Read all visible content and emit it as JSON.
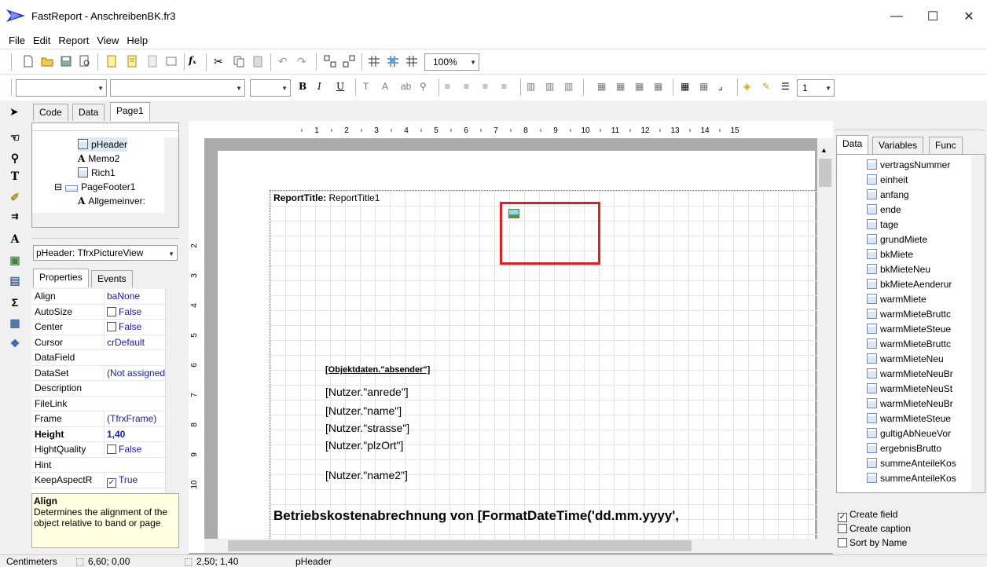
{
  "window": {
    "title": "FastReport - AnschreibenBK.fr3",
    "minimize": "—",
    "maximize": "☐",
    "close": "✕"
  },
  "menu": [
    "File",
    "Edit",
    "Report",
    "View",
    "Help"
  ],
  "toolbar": {
    "zoom": "100%",
    "line_width": "1"
  },
  "tabs": [
    "Code",
    "Data",
    "Page1"
  ],
  "tree": {
    "items": [
      {
        "label": "pHeader",
        "icon": "picture-icon"
      },
      {
        "label": "Memo2",
        "icon": "text-icon"
      },
      {
        "label": "Rich1",
        "icon": "rich-text-icon"
      },
      {
        "label": "PageFooter1",
        "icon": "band-icon"
      },
      {
        "label": "Allgemeinver:",
        "icon": "text-icon"
      }
    ]
  },
  "inspector": {
    "object_combo": "pHeader: TfrxPictureView",
    "tabs": [
      "Properties",
      "Events"
    ],
    "props": [
      {
        "name": "Align",
        "value": "baNone"
      },
      {
        "name": "AutoSize",
        "value": "False",
        "checkbox": true,
        "checked": false
      },
      {
        "name": "Center",
        "value": "False",
        "checkbox": true,
        "checked": false
      },
      {
        "name": "Cursor",
        "value": "crDefault"
      },
      {
        "name": "DataField",
        "value": ""
      },
      {
        "name": "DataSet",
        "value": "(Not assigned)"
      },
      {
        "name": "Description",
        "value": ""
      },
      {
        "name": "FileLink",
        "value": ""
      },
      {
        "name": "Frame",
        "value": "(TfrxFrame)",
        "expand": "⊞"
      },
      {
        "name": "Height",
        "value": "1,40",
        "bold": true
      },
      {
        "name": "HightQuality",
        "value": "False",
        "checkbox": true,
        "checked": false
      },
      {
        "name": "Hint",
        "value": ""
      },
      {
        "name": "KeepAspectR",
        "value": "True",
        "checkbox": true,
        "checked": true
      }
    ],
    "help_title": "Align",
    "help_text": "Determines the alignment of the object relative to band or page"
  },
  "ruler": {
    "top": [
      "1",
      "2",
      "3",
      "4",
      "5",
      "6",
      "7",
      "8",
      "9",
      "10",
      "11",
      "12",
      "13",
      "14",
      "15"
    ],
    "left": [
      "2",
      "3",
      "4",
      "5",
      "6",
      "7",
      "8",
      "9",
      "10"
    ]
  },
  "report": {
    "band_label_bold": "ReportTitle:",
    "band_label": " ReportTitle1",
    "fields": [
      "[Objektdaten.\"absender\"]",
      "[Nutzer.\"anrede\"]",
      "[Nutzer.\"name\"]",
      "[Nutzer.\"strasse\"]",
      "[Nutzer.\"plzOrt\"]",
      "[Nutzer.\"name2\"]"
    ],
    "heading": "Betriebskostenabrechnung von [FormatDateTime('dd.mm.yyyy',"
  },
  "right_panel": {
    "tabs": [
      "Data",
      "Variables",
      "Func"
    ],
    "fields": [
      "vertragsNummer",
      "einheit",
      "anfang",
      "ende",
      "tage",
      "grundMiete",
      "bkMiete",
      "bkMieteNeu",
      "bkMieteAenderur",
      "warmMiete",
      "warmMieteBruttc",
      "warmMieteSteue",
      "warmMieteBruttc",
      "warmMieteNeu",
      "warmMieteNeuBr",
      "warmMieteNeuSt",
      "warmMieteNeuBr",
      "warmMieteSteue",
      "gultigAbNeueVor",
      "ergebnisBrutto",
      "summeAnteileKos",
      "summeAnteileKos"
    ],
    "options": [
      {
        "label": "Create field",
        "checked": true
      },
      {
        "label": "Create caption",
        "checked": false
      },
      {
        "label": "Sort by Name",
        "checked": false
      }
    ]
  },
  "status": {
    "units": "Centimeters",
    "position": "6,60; 0,00",
    "size": "2,50; 1,40",
    "object": "pHeader"
  },
  "colors": {
    "selection": "#e02020",
    "canvas": "#ababab"
  }
}
